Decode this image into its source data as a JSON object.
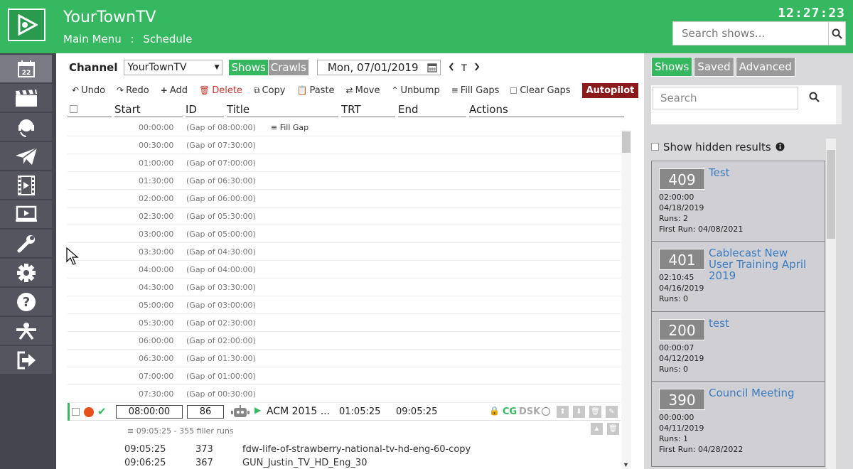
{
  "header": {
    "title": "YourTownTV",
    "breadcrumb": [
      "Main Menu",
      ":",
      "Schedule"
    ],
    "clock": "12:27:23",
    "search_placeholder": "Search shows...",
    "accent": "#35b860"
  },
  "sidebar": {
    "items": [
      "calendar-icon",
      "clapperboard-icon",
      "headset-icon",
      "paper-plane-icon",
      "film-icon",
      "monitor-play-icon",
      "wrench-icon",
      "gear-icon",
      "help-icon",
      "network-icon",
      "sign-out-icon"
    ]
  },
  "schedule": {
    "channel_label": "Channel",
    "channel_value": "YourTownTV",
    "toggle_shows": "Shows",
    "toggle_crawls": "Crawls",
    "date": "Mon, 07/01/2019",
    "nav_today": "T",
    "actions": {
      "undo": "Undo",
      "redo": "Redo",
      "add": "Add",
      "delete": "Delete",
      "copy": "Copy",
      "paste": "Paste",
      "move": "Move",
      "unbump": "Unbump",
      "fill_gaps": "Fill Gaps",
      "clear_gaps": "Clear Gaps",
      "autopilot": "Autopilot"
    },
    "columns": [
      "Start",
      "ID",
      "Title",
      "TRT",
      "End",
      "Actions"
    ],
    "fill_gap_label": "Fill Gap",
    "gap_rows": [
      {
        "time": "00:00:00",
        "gap": "(Gap of 08:00:00)"
      },
      {
        "time": "00:30:00",
        "gap": "(Gap of 07:30:00)"
      },
      {
        "time": "01:00:00",
        "gap": "(Gap of 07:00:00)"
      },
      {
        "time": "01:30:00",
        "gap": "(Gap of 06:30:00)"
      },
      {
        "time": "02:00:00",
        "gap": "(Gap of 06:00:00)"
      },
      {
        "time": "02:30:00",
        "gap": "(Gap of 05:30:00)"
      },
      {
        "time": "03:00:00",
        "gap": "(Gap of 05:00:00)"
      },
      {
        "time": "03:30:00",
        "gap": "(Gap of 04:30:00)"
      },
      {
        "time": "04:00:00",
        "gap": "(Gap of 04:00:00)"
      },
      {
        "time": "04:30:00",
        "gap": "(Gap of 03:30:00)"
      },
      {
        "time": "05:00:00",
        "gap": "(Gap of 03:00:00)"
      },
      {
        "time": "05:30:00",
        "gap": "(Gap of 02:30:00)"
      },
      {
        "time": "06:00:00",
        "gap": "(Gap of 02:00:00)"
      },
      {
        "time": "06:30:00",
        "gap": "(Gap of 01:30:00)"
      },
      {
        "time": "07:00:00",
        "gap": "(Gap of 01:00:00)"
      },
      {
        "time": "07:30:00",
        "gap": "(Gap of 00:30:00)"
      }
    ],
    "show_row": {
      "start": "08:00:00",
      "id": "86",
      "title": "ACM 2015 ...",
      "trt": "01:05:25",
      "end": "09:05:25",
      "cg": "CG",
      "dsk": "DSK"
    },
    "filler_text": "09:05:25 - 355 filler runs",
    "filler_rows": [
      {
        "time": "09:05:25",
        "id": "373",
        "title": "fdw-life-of-strawberry-national-tv-hd-eng-60-copy"
      },
      {
        "time": "09:06:25",
        "id": "367",
        "title": "GUN_Justin_TV_HD_Eng_30"
      }
    ]
  },
  "right_panel": {
    "tabs": [
      "Shows",
      "Saved",
      "Advanced"
    ],
    "search_placeholder": "Search",
    "show_hidden_label": "Show hidden results",
    "results": [
      {
        "id": "409",
        "title": "Test",
        "duration": "02:00:00",
        "date": "04/18/2019",
        "runs": "Runs: 2",
        "first_run": "First Run: 04/08/2021"
      },
      {
        "id": "401",
        "title": "Cablecast New User Training April 2019",
        "duration": "02:10:45",
        "date": "04/16/2019",
        "runs": "Runs: 0",
        "first_run": ""
      },
      {
        "id": "200",
        "title": "test",
        "duration": "00:00:07",
        "date": "04/12/2019",
        "runs": "Runs: 0",
        "first_run": ""
      },
      {
        "id": "390",
        "title": "Council Meeting",
        "duration": "00:00:00",
        "date": "04/11/2019",
        "runs": "Runs: 1",
        "first_run": "First Run: 04/28/2022"
      }
    ]
  }
}
